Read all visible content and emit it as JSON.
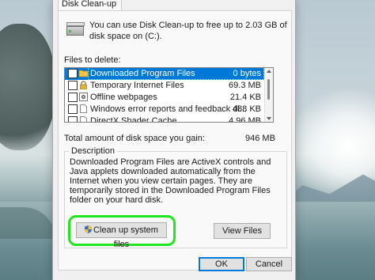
{
  "tab": {
    "label": "Disk Clean-up"
  },
  "intro": {
    "text": "You can use Disk Clean-up to free up to 2.03 GB of disk space on (C:)."
  },
  "files_label": "Files to delete:",
  "files": [
    {
      "name": "Downloaded Program Files",
      "size": "0 bytes",
      "checked": false,
      "selected": true,
      "icon": "folder-icon"
    },
    {
      "name": "Temporary Internet Files",
      "size": "69.3 MB",
      "checked": false,
      "selected": false,
      "icon": "lock-icon"
    },
    {
      "name": "Offline webpages",
      "size": "21.4 KB",
      "checked": false,
      "selected": false,
      "icon": "gear-page-icon"
    },
    {
      "name": "Windows error reports and feedback di...",
      "size": "488 KB",
      "checked": false,
      "selected": false,
      "icon": "document-icon"
    },
    {
      "name": "DirectX Shader Cache",
      "size": "4.96 MB",
      "checked": false,
      "selected": false,
      "icon": "document-icon"
    }
  ],
  "total": {
    "label": "Total amount of disk space you gain:",
    "value": "946 MB"
  },
  "description": {
    "title": "Description",
    "text": "Downloaded Program Files are ActiveX controls and Java applets downloaded automatically from the Internet when you view certain pages. They are temporarily stored in the Downloaded Program Files folder on your hard disk."
  },
  "buttons": {
    "clean_up_system_files": "Clean up system files",
    "view_files": "View Files",
    "ok": "OK",
    "cancel": "Cancel"
  },
  "colors": {
    "selection": "#0078d7",
    "highlight": "#22e61d"
  }
}
